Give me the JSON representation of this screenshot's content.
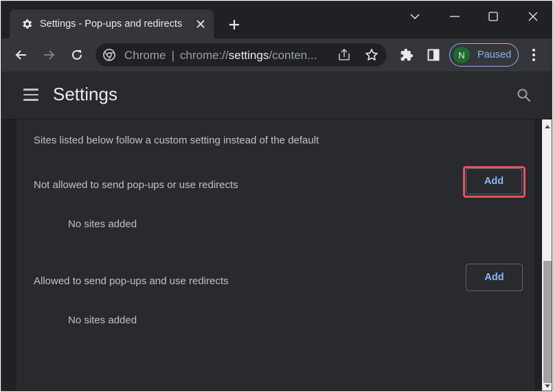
{
  "tab": {
    "title": "Settings - Pop-ups and redirects",
    "icon": "gear-icon"
  },
  "omnibox": {
    "site_label": "Chrome",
    "url_prefix": "chrome://",
    "url_host": "settings",
    "url_path": "/conten..."
  },
  "profile": {
    "initial": "N",
    "status": "Paused"
  },
  "header": {
    "title": "Settings"
  },
  "content": {
    "intro": "Sites listed below follow a custom setting instead of the default",
    "blocked": {
      "heading": "Not allowed to send pop-ups or use redirects",
      "button": "Add",
      "empty": "No sites added"
    },
    "allowed": {
      "heading": "Allowed to send pop-ups and use redirects",
      "button": "Add",
      "empty": "No sites added"
    }
  },
  "colors": {
    "accent": "#8ab4f8",
    "highlight": "#e0555d",
    "avatar": "#1e6b2e"
  }
}
